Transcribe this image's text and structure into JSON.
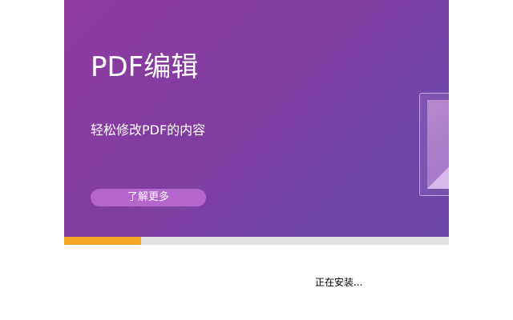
{
  "banner": {
    "title": "PDF编辑",
    "subtitle": "轻松修改PDF的内容",
    "learn_more_label": "了解更多"
  },
  "install": {
    "progress": 0.2,
    "status_text": "正在安装..."
  },
  "colors": {
    "banner_gradient_start": "#8f3c9f",
    "banner_gradient_end": "#6c44a8",
    "button": "#b466cc",
    "progress_fill": "#f5a623",
    "progress_track": "#e1e1e1"
  },
  "icons": {
    "preview_art": "document-preview-icon"
  }
}
